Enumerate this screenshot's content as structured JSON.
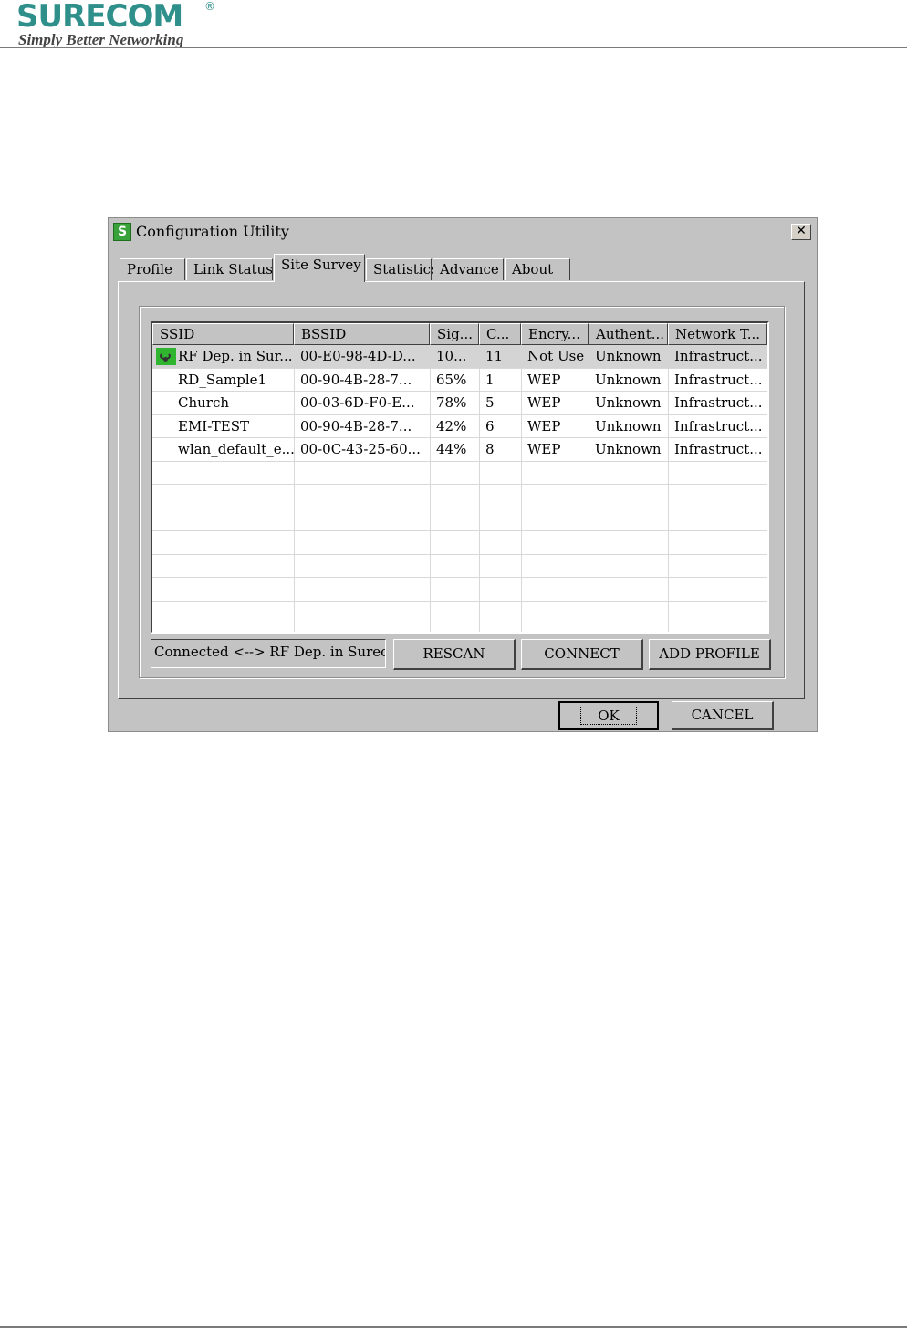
{
  "header": {
    "logo_text": "SURECOM",
    "logo_mark": "®",
    "tagline": "Simply Better Networking"
  },
  "window": {
    "title": "Configuration Utility",
    "close_label": "✕"
  },
  "tabs": [
    {
      "label": "Profile"
    },
    {
      "label": "Link Status"
    },
    {
      "label": "Site Survey"
    },
    {
      "label": "Statistics"
    },
    {
      "label": "Advance"
    },
    {
      "label": "About"
    }
  ],
  "active_tab": "Site Survey",
  "site_survey": {
    "columns": [
      "SSID",
      "BSSID",
      "Sig...",
      "C...",
      "Encry...",
      "Authent...",
      "Network T..."
    ],
    "rows": [
      {
        "ssid": "RF Dep. in Sur...",
        "bssid": "00-E0-98-4D-D...",
        "signal": "10...",
        "channel": "11",
        "encryption": "Not Use",
        "auth": "Unknown",
        "network": "Infrastruct...",
        "connected": true
      },
      {
        "ssid": "RD_Sample1",
        "bssid": "00-90-4B-28-7...",
        "signal": "65%",
        "channel": "1",
        "encryption": "WEP",
        "auth": "Unknown",
        "network": "Infrastruct...",
        "connected": false
      },
      {
        "ssid": "Church",
        "bssid": "00-03-6D-F0-E...",
        "signal": "78%",
        "channel": "5",
        "encryption": "WEP",
        "auth": "Unknown",
        "network": "Infrastruct...",
        "connected": false
      },
      {
        "ssid": "EMI-TEST",
        "bssid": "00-90-4B-28-7...",
        "signal": "42%",
        "channel": "6",
        "encryption": "WEP",
        "auth": "Unknown",
        "network": "Infrastruct...",
        "connected": false
      },
      {
        "ssid": "wlan_default_e...",
        "bssid": "00-0C-43-25-60...",
        "signal": "44%",
        "channel": "8",
        "encryption": "WEP",
        "auth": "Unknown",
        "network": "Infrastruct...",
        "connected": false
      }
    ],
    "status_text": "Connected <--> RF Dep. in Surecor",
    "rescan_label": "RESCAN",
    "connect_label": "CONNECT",
    "add_profile_label": "ADD PROFILE"
  },
  "dialog_buttons": {
    "ok_label": "OK",
    "cancel_label": "CANCEL"
  },
  "colors": {
    "window_bg": "#c3c3c3",
    "brand": "#2f8f8a",
    "connected_icon": "#2fb52f"
  }
}
